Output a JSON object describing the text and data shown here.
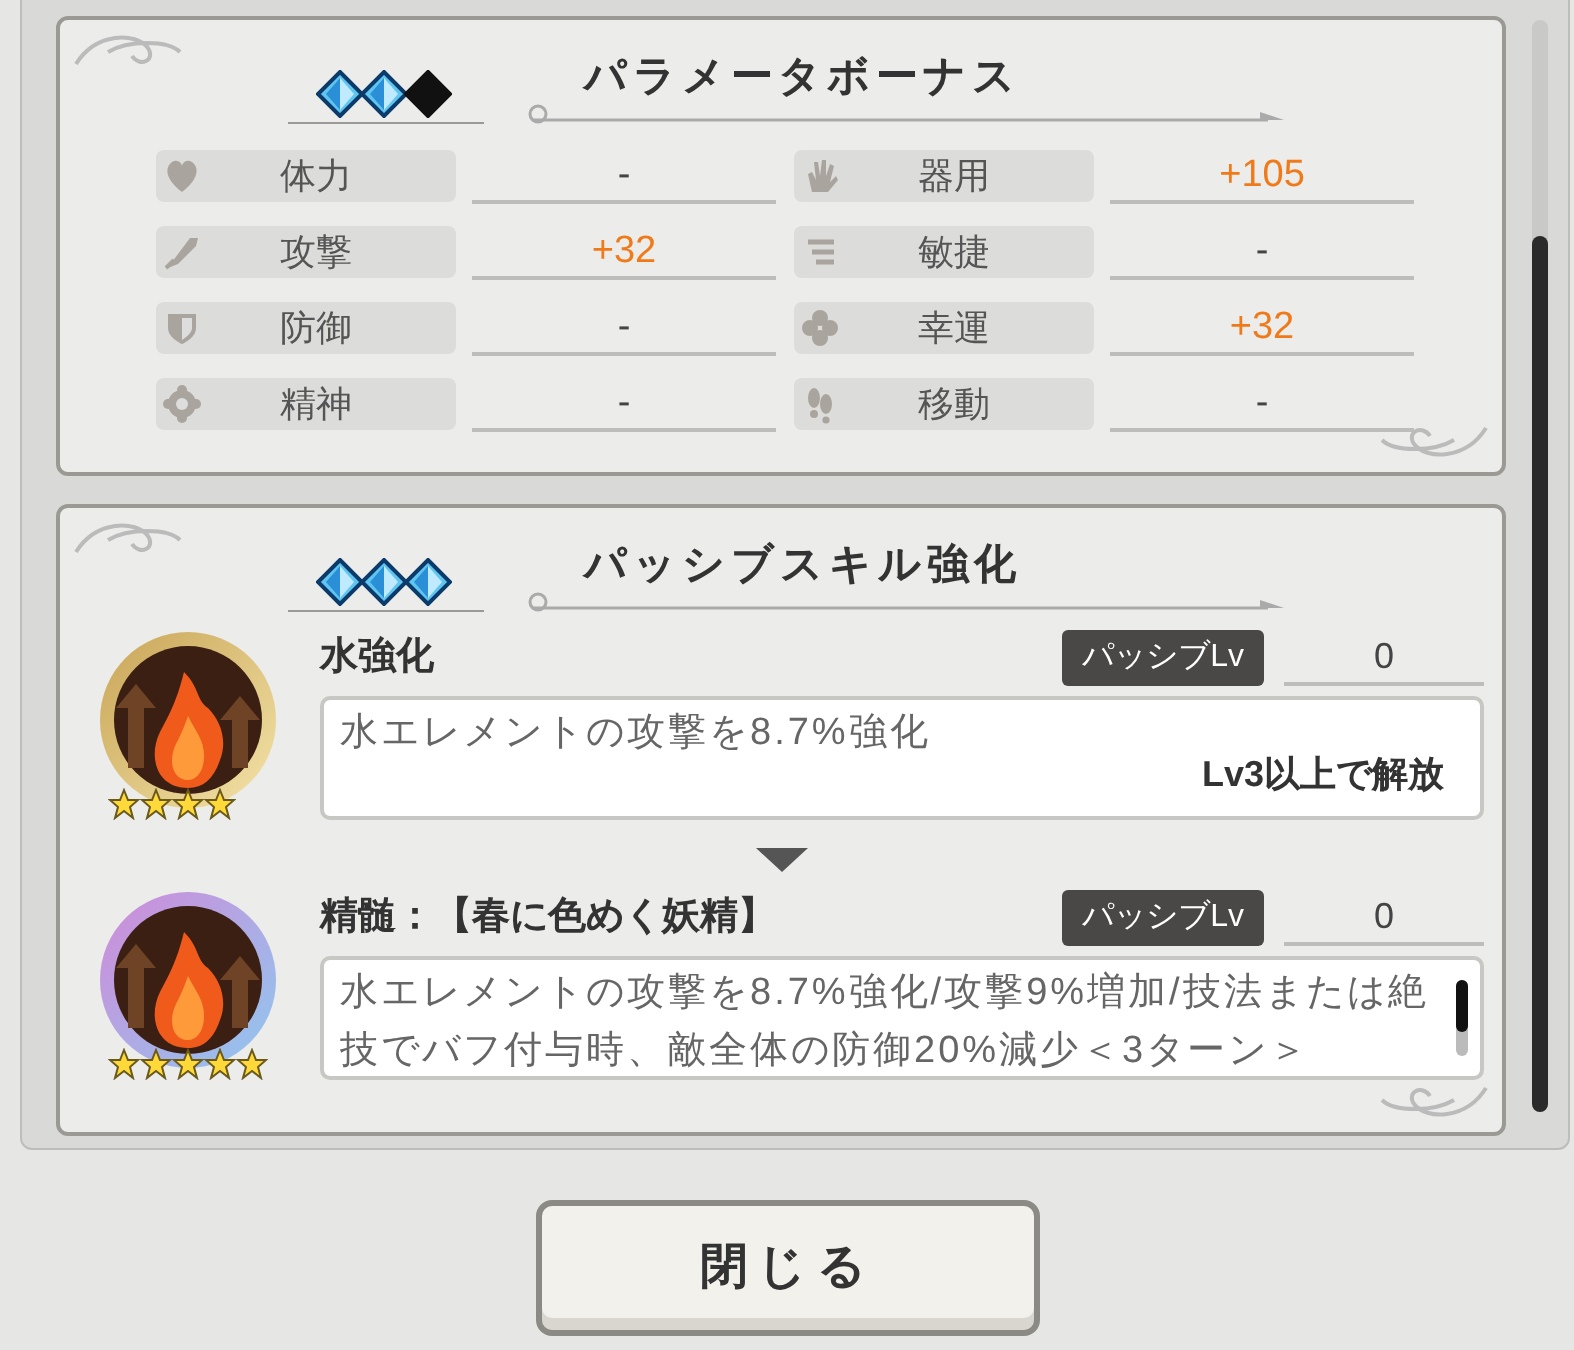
{
  "parameter_bonus": {
    "gems": [
      {
        "filled": true
      },
      {
        "filled": true
      },
      {
        "filled": false
      }
    ],
    "title": "パラメータボーナス",
    "stats": [
      {
        "label": "体力",
        "value": "-",
        "highlighted": false
      },
      {
        "label": "器用",
        "value": "+105",
        "highlighted": true
      },
      {
        "label": "攻撃",
        "value": "+32",
        "highlighted": true
      },
      {
        "label": "敏捷",
        "value": "-",
        "highlighted": false
      },
      {
        "label": "防御",
        "value": "-",
        "highlighted": false
      },
      {
        "label": "幸運",
        "value": "+32",
        "highlighted": true
      },
      {
        "label": "精神",
        "value": "-",
        "highlighted": false
      },
      {
        "label": "移動",
        "value": "-",
        "highlighted": false
      }
    ]
  },
  "passive_skill": {
    "gems": [
      {
        "filled": true
      },
      {
        "filled": true
      },
      {
        "filled": true
      }
    ],
    "title": "パッシブスキル強化",
    "skills": [
      {
        "name": "水強化",
        "badge": "パッシブLv",
        "level_value": "0",
        "description": "水エレメントの攻撃を8.7%強化",
        "unlock": "Lv3以上で解放",
        "stars": 4
      },
      {
        "name": "精髄：【春に色めく妖精】",
        "badge": "パッシブLv",
        "level_value": "0",
        "description": "水エレメントの攻撃を8.7%強化/攻撃9%増加/技法または絶技でバフ付与時、敵全体の防御20%減少＜3ターン＞",
        "stars": 5
      }
    ]
  },
  "close_button": "閉じる"
}
